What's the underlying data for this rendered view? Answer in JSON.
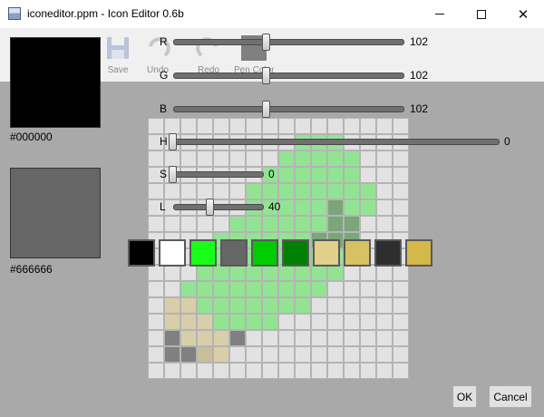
{
  "window": {
    "title": "iconeditor.ppm - Icon Editor 0.6b",
    "minimize": "–",
    "maximize": "☐",
    "close": "✕"
  },
  "toolbar_behind": {
    "items": [
      {
        "label": "Save",
        "icon": "save-icon"
      },
      {
        "label": "Undo",
        "icon": "undo-icon"
      },
      {
        "label": "Redo",
        "icon": "redo-icon"
      },
      {
        "label": "Pen Color",
        "icon": "pen-color-icon"
      }
    ]
  },
  "primary_color": {
    "hex": "#000000",
    "swatch": "#000000"
  },
  "secondary_color": {
    "hex": "#666666",
    "swatch": "#666666"
  },
  "sliders": [
    {
      "label": "R",
      "value": "102",
      "fraction": 0.4
    },
    {
      "label": "G",
      "value": "102",
      "fraction": 0.4
    },
    {
      "label": "B",
      "value": "102",
      "fraction": 0.4
    },
    {
      "label": "H",
      "value": "0",
      "fraction": 0.0
    },
    {
      "label": "S",
      "value": "0",
      "fraction": 0.0
    },
    {
      "label": "L",
      "value": "40",
      "fraction": 0.4
    }
  ],
  "palette": [
    "#000000",
    "#ffffff",
    "#1aff1a",
    "#666666",
    "#00cc00",
    "#008000",
    "#e0d08a",
    "#d6c263",
    "#2e2e2e",
    "#d4b84a"
  ],
  "buttons": {
    "ok": "OK",
    "cancel": "Cancel"
  },
  "colors": {
    "dim": "#a9a9a9",
    "cell_light": "#e2e2e2",
    "cell_grey": "#a0a0a0",
    "cell_dark": "#808080",
    "cell_green_light": "#92e492",
    "cell_green_mid": "#72d072",
    "cell_green_dim": "#7aa67a",
    "cell_tan": "#d8ceaa",
    "cell_tan_dim": "#c8be9a"
  },
  "icon_grid": [
    "AAAAAAAAAAAAAAAA",
    "AAAAAAAAAGGGAAAA",
    "AAAAAAAAGGGGGAAA",
    "AAAAAAAGGGGGGAAA",
    "AAAAAAGGGGGGGGAA",
    "AAAAAAGGGGGHGGAA",
    "AAAAAGGGGGGHHAAA",
    "AAAAGGGGGGHHHAAA",
    "AAAGGGGGGGGGHAAA",
    "AAAGGGGGGGGGAAAA",
    "AAGGGGGGGGGAAAAA",
    "ATTGGGGGGGAAAAAA",
    "ATTTGGGGAAAAAAAA",
    "AMTTTMAAAAAAAAAA",
    "AMMNTAAAAAAAAAAA",
    "AAAAAAAAAAAAAAAA"
  ]
}
